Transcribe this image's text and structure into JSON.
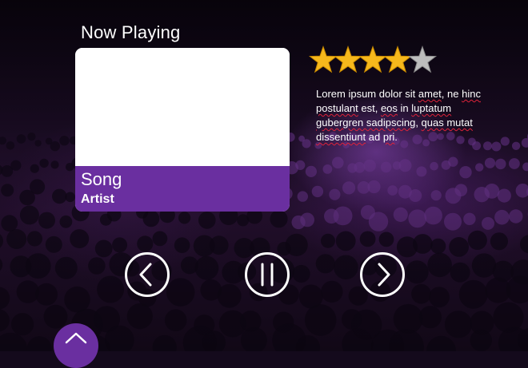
{
  "now_playing": {
    "title": "Now Playing",
    "song": "Song",
    "artist": "Artist"
  },
  "rating": {
    "value": 4,
    "max": 5,
    "filled_color": "#f6b81c",
    "empty_color": "#bdbdbd"
  },
  "description": {
    "segments": [
      {
        "text": "Lorem ipsum dolor sit ",
        "u": false
      },
      {
        "text": "amet",
        "u": true
      },
      {
        "text": ", ne ",
        "u": false
      },
      {
        "text": "hinc postulant",
        "u": true
      },
      {
        "text": " est, ",
        "u": false
      },
      {
        "text": "eos",
        "u": true
      },
      {
        "text": " in ",
        "u": false
      },
      {
        "text": "luptatum gubergren sadipscing",
        "u": true
      },
      {
        "text": ", ",
        "u": false
      },
      {
        "text": "quas mutat dissentiunt",
        "u": true
      },
      {
        "text": " ad ",
        "u": false
      },
      {
        "text": "pri",
        "u": true
      },
      {
        "text": ".",
        "u": false
      }
    ]
  },
  "controls": {
    "previous_icon": "chevron-left-icon",
    "pause_icon": "pause-icon",
    "next_icon": "chevron-right-icon",
    "expand_icon": "chevron-up-icon"
  },
  "colors": {
    "accent": "#6a2fa0",
    "card_art": "#ffffff",
    "text": "#ffffff"
  }
}
